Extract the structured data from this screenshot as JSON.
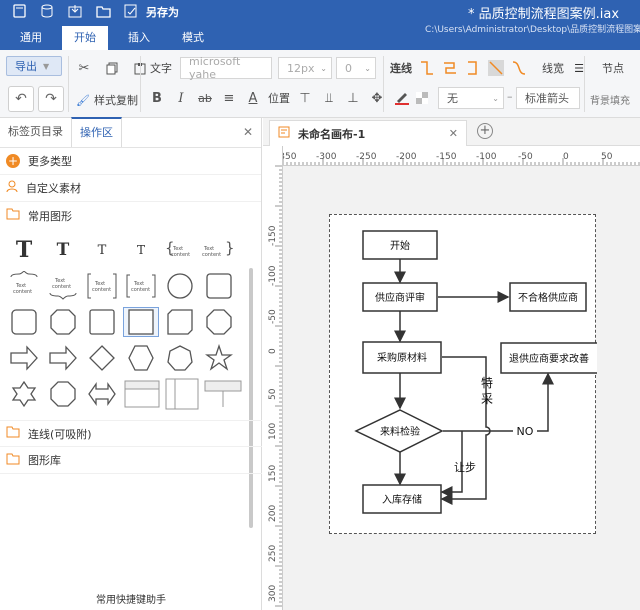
{
  "title_bar": {
    "save_as": "另存为",
    "doc_title": "* 品质控制流程图案例.iax",
    "doc_path": "C:\\Users\\Administrator\\Desktop\\品质控制流程图案例"
  },
  "menu_tabs": [
    "通用",
    "开始",
    "插入",
    "模式"
  ],
  "ribbon": {
    "export": "导出",
    "style_copy": "样式复制",
    "text_label": "文字",
    "font_family": "microsoft yahe",
    "font_size": "12px",
    "letter_spacing": "0",
    "position": "位置",
    "connector": "连线",
    "line_width": "线宽",
    "node": "节点",
    "fill_none": "无",
    "arrow": "标准箭头",
    "bg_fill": "背景填充"
  },
  "panel": {
    "tabs": [
      "标签页目录",
      "操作区"
    ],
    "more_types": "更多类型",
    "custom_material": "自定义素材",
    "common_shapes": "常用图形",
    "connector_row": "连线(可吸附)",
    "shape_library": "图形库",
    "helper": "常用快捷键助手",
    "text_content": "Text content"
  },
  "doc_tab": {
    "name": "未命名画布-1"
  },
  "ruler": {
    "top": [
      "-350",
      "-300",
      "-250",
      "-200",
      "-150",
      "-100",
      "-50",
      "0",
      "50"
    ],
    "left": [
      "-150",
      "-100",
      "-50",
      "0",
      "50",
      "100",
      "150",
      "200",
      "250",
      "300"
    ]
  },
  "flow": {
    "start": "开始",
    "supplier_review": "供应商评审",
    "unqualified": "不合格供应商",
    "purchase": "采购原材料",
    "improve": "退供应商要求改善",
    "inspect": "来料检验",
    "store": "入库存储",
    "special": "特",
    "special2": "采",
    "concession": "让步",
    "no": "NO"
  }
}
